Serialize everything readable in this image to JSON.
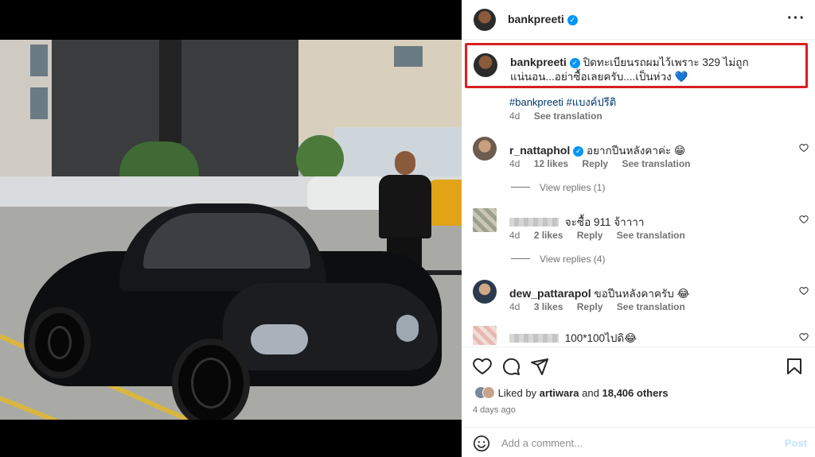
{
  "post": {
    "username": "bankpreeti",
    "caption_username": "bankpreeti",
    "caption_text": "ปิดทะเบียนรถผมไว้เพราะ 329 ไม่ถูกแน่นอน...อย่าซื้อเลยครับ....เป็นห่วง",
    "caption_emoji": "💙",
    "hashtags": "#bankpreeti #แบงค์ปรีติ",
    "age": "4d",
    "see_translation": "See translation"
  },
  "comments": [
    {
      "username": "r_nattaphol",
      "verified": true,
      "text": "อยากปีนหลังคาค่ะ 😁",
      "age": "4d",
      "likes": "12 likes",
      "reply": "Reply",
      "translate": "See translation",
      "view_replies": "View replies (1)"
    },
    {
      "username": "",
      "verified": false,
      "text": "จะซื้อ 911 จ้าาาา",
      "age": "4d",
      "likes": "2 likes",
      "reply": "Reply",
      "translate": "See translation",
      "view_replies": "View replies (4)"
    },
    {
      "username": "dew_pattarapol",
      "verified": false,
      "text": "ขอปีนหลังคาครับ 😂",
      "age": "4d",
      "likes": "3 likes",
      "reply": "Reply",
      "translate": "See translation"
    },
    {
      "username": "",
      "verified": false,
      "text": "100*100ไปดิ😂"
    }
  ],
  "likes_bar": {
    "prefix": "Liked by",
    "liker": "artiwara",
    "and": "and",
    "others": "18,406 others",
    "time": "4 days ago"
  },
  "add_comment": {
    "placeholder": "Add a comment...",
    "post_label": "Post"
  },
  "icons": {
    "verified": "verified-badge-icon",
    "more": "more-options-icon",
    "like": "heart-icon",
    "comment": "comment-icon",
    "share": "share-icon",
    "save": "bookmark-icon",
    "emoji": "emoji-icon"
  },
  "colors": {
    "highlight_box": "#d91f1f",
    "link": "#00376b",
    "verified": "#0095f6",
    "post_button_disabled": "#c5e3fb"
  }
}
